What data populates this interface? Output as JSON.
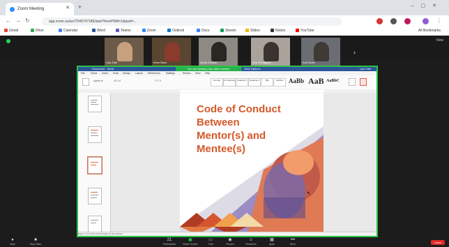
{
  "browser": {
    "tab_title": "Zoom Meeting",
    "url": "app.zoom.us/wc/7049747186/start?fromPWA=1&pwd=...",
    "bookmarks": [
      "Gmail",
      "Drive",
      "Calendar",
      "Word",
      "Teams",
      "Zoom",
      "Outlook",
      "Docs",
      "Sheets",
      "Slides",
      "Notion",
      "YouTube",
      "All Bookmarks"
    ]
  },
  "zoom": {
    "participants": [
      {
        "name": "Lisa Tate"
      },
      {
        "name": "Irene Blom"
      },
      {
        "name": "Maria Kessler"
      },
      {
        "name": "Ana Rodrigues"
      },
      {
        "name": "Kat Dover"
      }
    ],
    "view_label": "View",
    "controls": [
      {
        "icon": "mic-icon",
        "label": "Mute"
      },
      {
        "icon": "video-icon",
        "label": "Stop Video"
      },
      {
        "icon": "participants-icon",
        "label": "Participants"
      },
      {
        "icon": "share-icon",
        "label": "Share Screen"
      },
      {
        "icon": "chat-icon",
        "label": "Chat"
      },
      {
        "icon": "record-icon",
        "label": "Record"
      },
      {
        "icon": "reactions-icon",
        "label": "Reactions"
      },
      {
        "icon": "apps-icon",
        "label": "Apps"
      },
      {
        "icon": "more-icon",
        "label": "More"
      }
    ],
    "participant_count": "21",
    "leave_label": "Leave"
  },
  "shared_doc": {
    "window_title": "Document - Word",
    "sharing_banner": "You are viewing Lisa Tate's screen",
    "view_options_label": "View Options",
    "user": "Lisa Tate",
    "menu": [
      "File",
      "Home",
      "Insert",
      "Draw",
      "Design",
      "Layout",
      "References",
      "Mailings",
      "Review",
      "View",
      "Help"
    ],
    "styles": [
      "Normal",
      "No Spacing",
      "Heading 1",
      "Heading 2",
      "Title",
      "Subtitle"
    ],
    "ribbon_big_text": [
      "AaBb",
      "AaB",
      "AaBbC"
    ],
    "title": "Code of Conduct\nBetween\nMentor(s) and\nMentee(s)",
    "status_text": "Page 1 of 5  1,204 words  English (United States)"
  },
  "colors": {
    "zoom_green": "#2cc24a",
    "word_blue": "#2b579a",
    "title_orange": "#d4592b",
    "leave_red": "#e02828"
  }
}
